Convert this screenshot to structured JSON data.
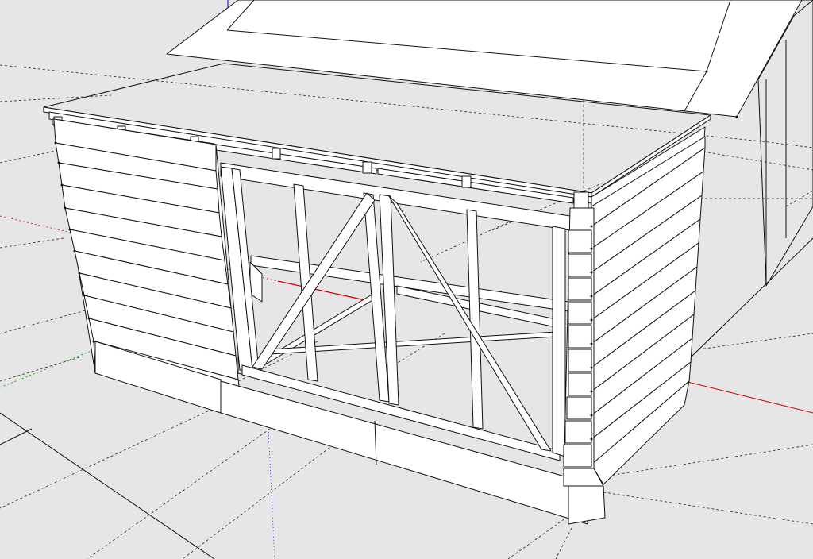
{
  "viewport": {
    "background": "#e6e6e6",
    "edge_color": "#111111",
    "face_color": "#ffffff",
    "roof_color": "#d9d9d9"
  },
  "axes": {
    "red": "#cc0000",
    "green": "#009900",
    "blue": "#0000cc"
  }
}
